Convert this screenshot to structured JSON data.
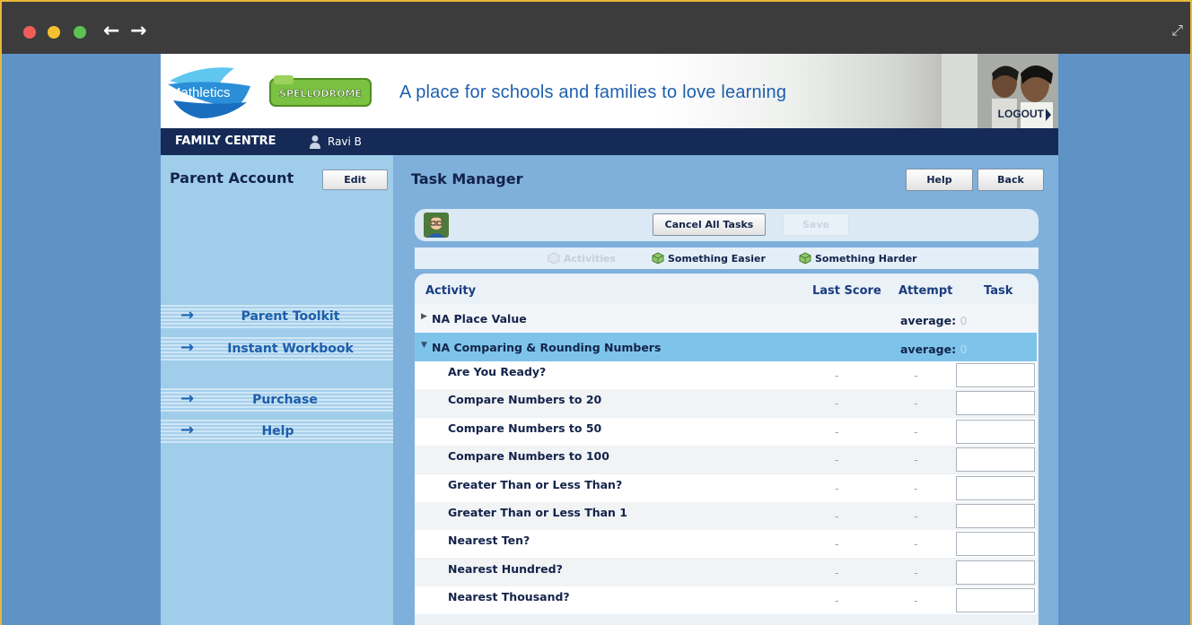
{
  "browser": {
    "back_glyph": "←",
    "forward_glyph": "→",
    "expand_glyph": "⤢"
  },
  "header": {
    "logo_mathletics": "Mathletics",
    "logo_spellodrome": "SPELLODROME",
    "tagline": "A place for schools and families to love learning",
    "logout_label": "LOGOUT"
  },
  "family_bar": {
    "title": "FAMILY CENTRE",
    "user_name": "Ravi B"
  },
  "left_panel": {
    "title": "Parent Account",
    "edit_label": "Edit",
    "menu": [
      {
        "label": "Parent Toolkit"
      },
      {
        "label": "Instant Workbook"
      },
      {
        "label": "Purchase"
      },
      {
        "label": "Help"
      }
    ]
  },
  "main": {
    "title": "Task Manager",
    "help_label": "Help",
    "back_label": "Back",
    "cancel_all_label": "Cancel All Tasks",
    "save_label": "Save",
    "filters": {
      "activities": "Activities",
      "easier": "Something Easier",
      "harder": "Something Harder"
    },
    "table": {
      "headers": {
        "activity": "Activity",
        "last_score": "Last Score",
        "attempt": "Attempt",
        "task": "Task"
      },
      "groups": [
        {
          "name": "NA Place Value",
          "avg_label": "average:",
          "avg_value": "0",
          "expanded": false
        },
        {
          "name": "NA Comparing & Rounding Numbers",
          "avg_label": "average:",
          "avg_value": "0",
          "expanded": true
        }
      ],
      "rows": [
        {
          "name": "Are You Ready?",
          "last_score": "-",
          "attempt": "-"
        },
        {
          "name": "Compare Numbers to 20",
          "last_score": "-",
          "attempt": "-"
        },
        {
          "name": "Compare Numbers to 50",
          "last_score": "-",
          "attempt": "-"
        },
        {
          "name": "Compare Numbers to 100",
          "last_score": "-",
          "attempt": "-"
        },
        {
          "name": "Greater Than or Less Than?",
          "last_score": "-",
          "attempt": "-"
        },
        {
          "name": "Greater Than or Less Than 1",
          "last_score": "-",
          "attempt": "-"
        },
        {
          "name": "Nearest Ten?",
          "last_score": "-",
          "attempt": "-"
        },
        {
          "name": "Nearest Hundred?",
          "last_score": "-",
          "attempt": "-"
        },
        {
          "name": "Nearest Thousand?",
          "last_score": "-",
          "attempt": "-"
        }
      ]
    }
  },
  "colors": {
    "page_bg": "#5f93c6",
    "navy": "#152a56",
    "accent_blue": "#1e5eaa",
    "selected_row": "#7ec4ea"
  }
}
